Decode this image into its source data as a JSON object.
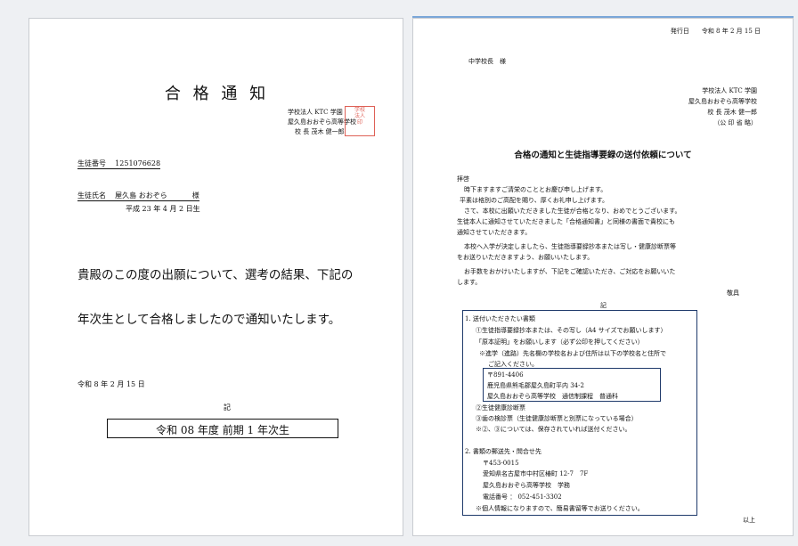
{
  "page1": {
    "title": "合 格 通 知",
    "school_lines": [
      "学校法人 KTC 学園",
      "屋久島おおぞら高等学校",
      "校 長 茂木 健一郎"
    ],
    "student_number_label": "生徒番号",
    "student_number": "1251076628",
    "student_name_label": "生徒氏名",
    "student_name": "屋久島 おおぞら",
    "honorific": "様",
    "birthdate": "平成 23 年 4 月 2 日生",
    "body_line1": "貴殿のこの度の出願について、選考の結果、下記の",
    "body_line2": "年次生として合格しましたので通知いたします。",
    "date": "令和 8 年 2 月 15 日",
    "ki": "記",
    "admission": "令和 08 年度 前期 1 年次生"
  },
  "page2": {
    "issue_date": "発行日　　令和 8 年 2 月 15 日",
    "addressee": "中学校長　様",
    "sender_lines": [
      "学校法人 KTC 学園",
      "屋久島おおぞら高等学校",
      "校 長 茂木 健一郎",
      "（公 印 省 略）"
    ],
    "subject": "合格の通知と生徒指導要録の送付依頼について",
    "greeting": "拝啓",
    "body_lines": [
      "時下ますますご清栄のこととお慶び申し上げます。",
      "平素は格別のご高配を賜り、厚くお礼申し上げます。",
      "さて、本校に出願いただきました生徒が合格となり、おめでとうございます。",
      "生徒本人に通知させていただきました「合格通知書」と同様の書面で貴校にも",
      "通知させていただきます。",
      "本校へ入学が決定しましたら、生徒指導要録抄本または写し・健康診断票等",
      "をお送りいただきますよう、お願いいたします。",
      "お手数をおかけいたしますが、下記をご確認いただき、ご対応をお願いいた",
      "します。"
    ],
    "closing": "敬具",
    "ki": "記",
    "section1_lines": [
      "1.  送付いただきたい書類",
      "①生徒指導要録抄本または、その写し（A4 サイズでお願いします）",
      "「原本証明」をお願いします（必ず公印を押してください）",
      "※進学（進路）先名欄の学校名および住所は以下の学校名と住所で",
      "ご記入ください。"
    ],
    "address_lines": [
      "〒891-4406",
      "鹿児島県熊毛郡屋久島町平内 34-2",
      "屋久島おおぞら高等学校　通信制課程　普通科"
    ],
    "section1_rest": [
      "②生徒健康診断票",
      "③歯の検診票（生徒健康診断票と別票になっている場合）",
      "※②、③については、保存されていれば送付ください。"
    ],
    "section2_lines": [
      "2.  書類の郵送先・問合せ先",
      "〒453-0015",
      "愛知県名古屋市中村区椿町 12-7　7F",
      "屋久島おおぞら高等学校　学務",
      "電話番号 ： 052-451-3302",
      "※個人情報になりますので、簡易書留等でお送りください。"
    ],
    "ijou": "以上"
  }
}
